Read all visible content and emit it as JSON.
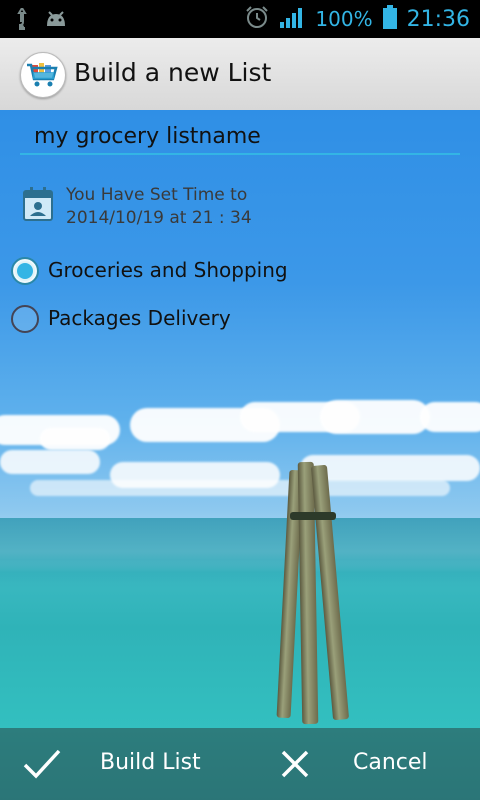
{
  "status_bar": {
    "icons": [
      "usb-icon",
      "android-icon",
      "alarm-icon",
      "signal-icon",
      "battery-icon"
    ],
    "battery": "100%",
    "time": "21:36"
  },
  "titlebar": {
    "title": "Build a new List",
    "app_icon": "shopping-cart-icon"
  },
  "form": {
    "list_name_value": "my grocery listname",
    "time_line1": "You Have Set Time to",
    "time_line2": "2014/10/19 at 21 : 34",
    "options": [
      {
        "label": "Groceries and Shopping",
        "checked": true
      },
      {
        "label": "Packages Delivery",
        "checked": false
      }
    ]
  },
  "actions": {
    "build_label": "Build List",
    "cancel_label": "Cancel"
  },
  "colors": {
    "accent": "#33b5e5",
    "statusbar": "#000000",
    "titlebar": "#e4e4e4"
  }
}
